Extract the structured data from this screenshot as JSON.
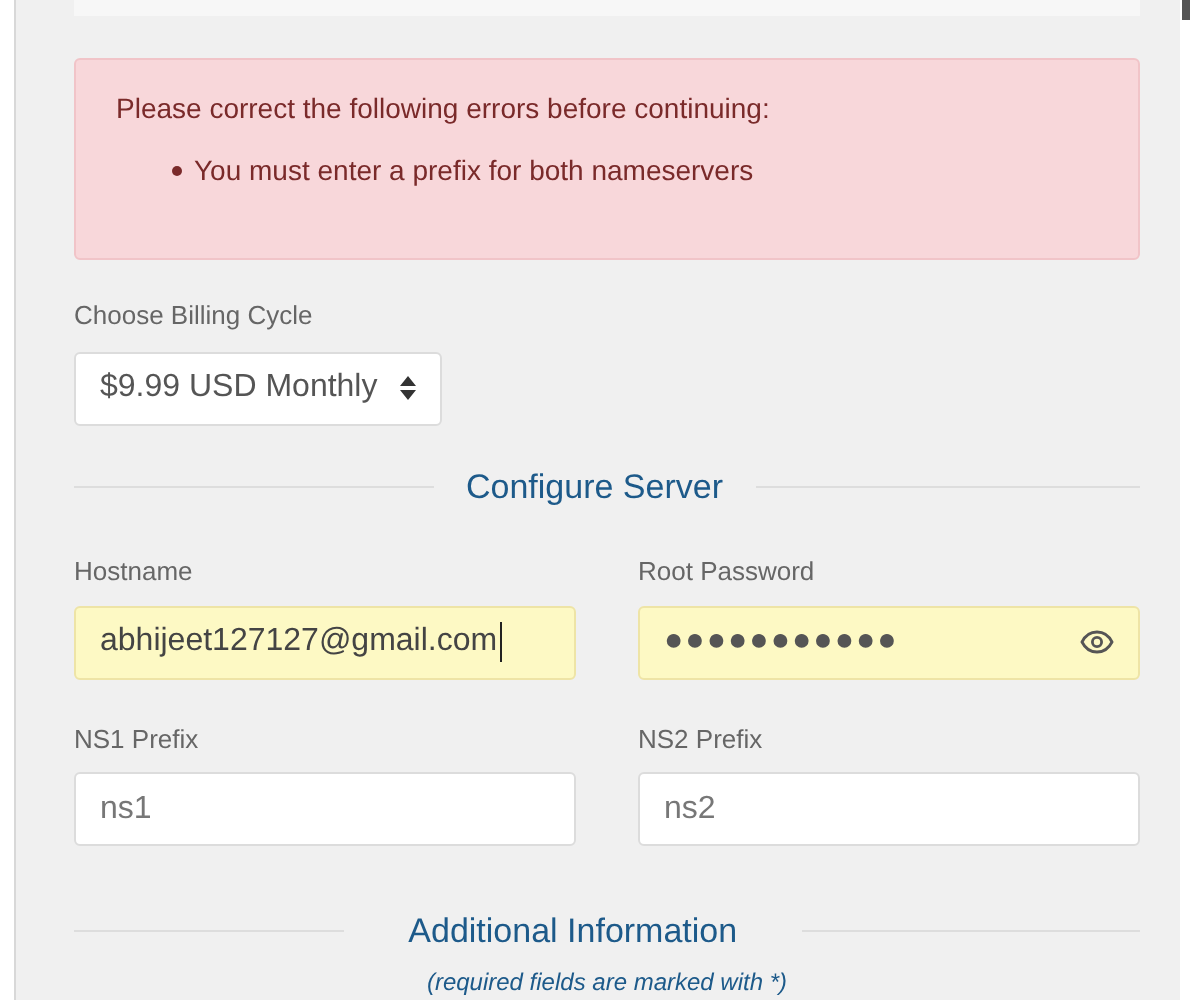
{
  "alert": {
    "title": "Please correct the following errors before continuing:",
    "errors": [
      "You must enter a prefix for both nameservers"
    ]
  },
  "billing_cycle": {
    "label": "Choose Billing Cycle",
    "value": "$9.99 USD Monthly"
  },
  "configure_server": {
    "heading": "Configure Server",
    "fields": [
      {
        "label": "Hostname",
        "value": "abhijeet127127@gmail.com",
        "kind": "text",
        "autofilled": true,
        "focused": true
      },
      {
        "label": "Root Password",
        "value": "●●●●●●●●●●●",
        "kind": "password",
        "autofilled": true,
        "focused": false
      },
      {
        "label": "NS1 Prefix",
        "placeholder": "ns1",
        "kind": "text",
        "autofilled": false,
        "focused": false
      },
      {
        "label": "NS2 Prefix",
        "placeholder": "ns2",
        "kind": "text",
        "autofilled": false,
        "focused": false
      }
    ]
  },
  "additional_information": {
    "heading": "Additional Information",
    "note": "(required fields are marked with *)"
  }
}
